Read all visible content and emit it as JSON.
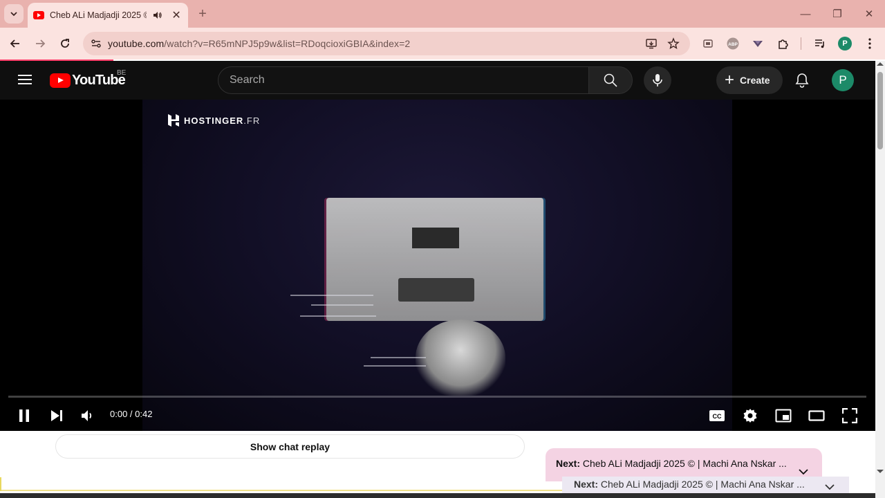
{
  "browser": {
    "tab": {
      "title": "Cheb ALi Madjadji 2025 © |",
      "close_glyph": "✕"
    },
    "new_tab_glyph": "+",
    "window": {
      "minimize": "—",
      "restore": "❐",
      "close": "✕"
    },
    "url": {
      "host": "youtube.com",
      "path": "/watch?v=R65mNPJ5p9w&list=RDoqcioxiGBIA&index=2"
    },
    "profile_initial": "P"
  },
  "youtube": {
    "country_code": "BE",
    "logo_text": "YouTube",
    "search": {
      "placeholder": "Search"
    },
    "create_label": "Create",
    "avatar_initial": "P",
    "ad": {
      "sponsor_name": "HOSTINGER",
      "sponsor_tld": ".FR"
    },
    "player": {
      "time_current": "0:00",
      "time_separator": " / ",
      "time_total": "0:42",
      "progress_fraction": 0.0
    },
    "below_player": {
      "chat_replay_label": "Show chat replay",
      "next_label": "Next:",
      "next_title": "Cheb ALi Madjadji 2025 © | Machi Ana Nskar ...",
      "next_ghost_label": "Next:",
      "next_ghost_title": "Cheb ALi Madjadji 2025 © | Machi Ana Nskar ..."
    }
  },
  "colors": {
    "tabstrip": "#e9b2ae",
    "toolbar": "#fbe3e0",
    "yt_red": "#ff0000",
    "yt_dark": "#0f0f0f",
    "profile_green": "#1c8a68",
    "next_card": "#f4d3e3"
  },
  "icons": [
    "tab-search-icon",
    "audio-playing-icon",
    "back-arrow-icon",
    "forward-arrow-icon",
    "reload-icon",
    "site-info-icon",
    "install-app-icon",
    "bookmark-star-icon",
    "cast-icon",
    "adblock-icon",
    "vpn-icon",
    "extensions-icon",
    "media-controls-icon",
    "kebab-menu-icon",
    "hamburger-icon",
    "search-icon",
    "mic-icon",
    "bell-icon",
    "pause-icon",
    "next-icon",
    "volume-icon",
    "captions-icon",
    "settings-gear-icon",
    "miniplayer-icon",
    "theater-icon",
    "fullscreen-icon",
    "chevron-down-icon"
  ]
}
